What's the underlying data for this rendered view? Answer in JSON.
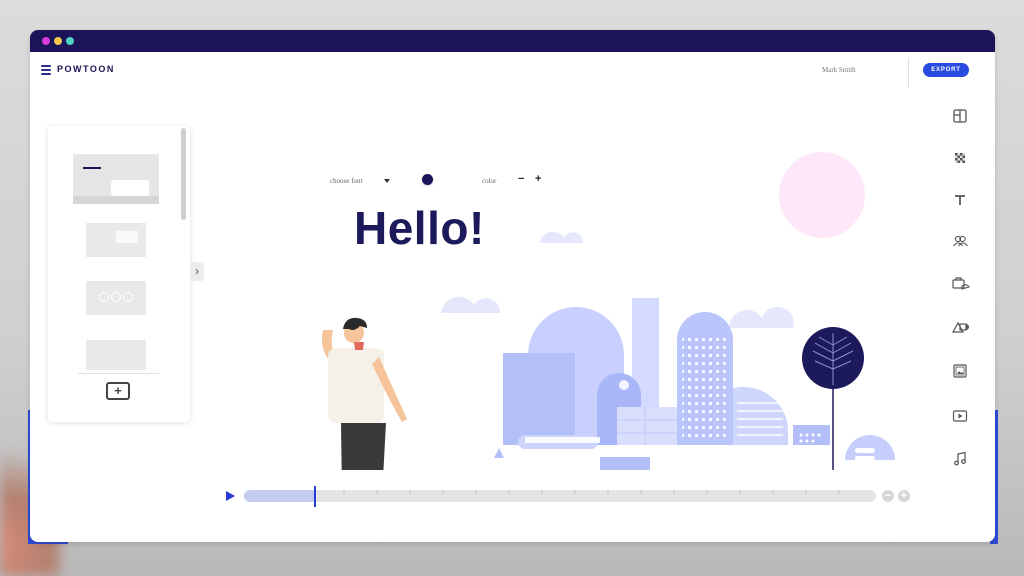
{
  "app": {
    "brand": "POWTOON",
    "user_name": "Mark Smith",
    "export_label": "EXPORT"
  },
  "window_dots": {
    "colors": [
      "#d63ad8",
      "#f2c94c",
      "#4fd3c4"
    ]
  },
  "editor": {
    "choose_font_label": "choose font",
    "color_label": "color",
    "minus_label": "−",
    "plus_label": "+",
    "canvas_title": "Hello!"
  },
  "slides_panel": {
    "add_label": "+"
  },
  "right_toolbar": {
    "icons": [
      "layout-icon",
      "background-icon",
      "text-icon",
      "characters-icon",
      "props-icon",
      "shapes-icon",
      "images-icon",
      "video-icon",
      "music-icon"
    ]
  },
  "timeline": {
    "progress": 0.11,
    "zoom_out_label": "−",
    "zoom_in_label": "+"
  },
  "colors": {
    "accent": "#2a4be0",
    "titlebar": "#1c1458",
    "ground": "#8ef5d3",
    "buildings": "#b9c3fb",
    "pink_circle": "#fde7f8"
  }
}
